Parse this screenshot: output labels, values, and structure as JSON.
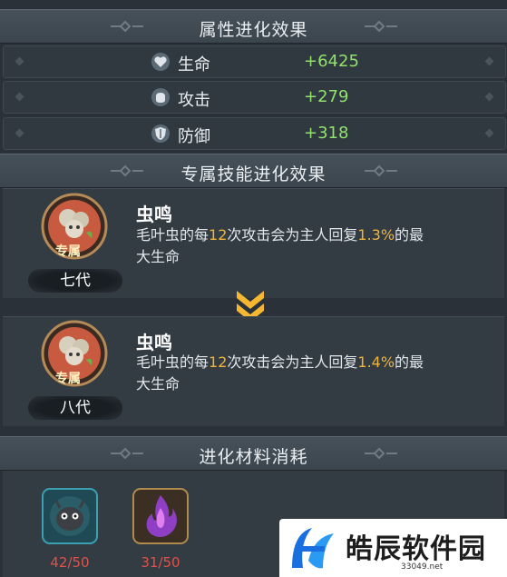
{
  "attr_section": {
    "title": "属性进化效果"
  },
  "stats": [
    {
      "icon": "heart-shield-icon",
      "label": "生命",
      "value": "+6425"
    },
    {
      "icon": "fist-icon",
      "label": "攻击",
      "value": "+279"
    },
    {
      "icon": "shield-icon",
      "label": "防御",
      "value": "+318"
    }
  ],
  "skill_section": {
    "title": "专属技能进化效果"
  },
  "skills": [
    {
      "badge": "专属",
      "generation": "七代",
      "name": "虫鸣",
      "desc_parts": [
        "毛叶虫的每",
        "12",
        "次攻击会为主人回复",
        "1.3%",
        "的最",
        "大生命"
      ]
    },
    {
      "badge": "专属",
      "generation": "八代",
      "name": "虫鸣",
      "desc_parts": [
        "毛叶虫的每",
        "12",
        "次攻击会为主人回复",
        "1.4%",
        "的最",
        "大生命"
      ]
    }
  ],
  "materials_section": {
    "title": "进化材料消耗"
  },
  "materials": [
    {
      "icon": "beetle-pet-icon",
      "count": "42/50"
    },
    {
      "icon": "purple-flame-crystal-icon",
      "count": "31/50"
    }
  ],
  "watermark": {
    "text": "皓辰软件园",
    "url": "33049.net"
  },
  "colors": {
    "stat_value": "#8fe36a",
    "highlight": "#f0b43a",
    "shortage": "#e0524a",
    "arrow": "#f5b731"
  }
}
